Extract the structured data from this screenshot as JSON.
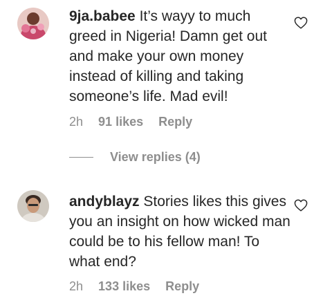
{
  "comments": [
    {
      "username": "9ja.babee",
      "text": "It’s wayy to much greed in Nigeria! Damn get out and make your own money instead of killing and taking someone’s life. Mad evil!",
      "time": "2h",
      "likes": "91 likes",
      "reply_label": "Reply",
      "avatar_icon": "avatar-photo",
      "like_icon": "heart-outline-icon",
      "view_replies_label": "View replies (4)"
    },
    {
      "username": "andyblayz",
      "text": "Stories likes this gives you an insight on how wicked man could be to his fellow man! To what end?",
      "time": "2h",
      "likes": "133 likes",
      "reply_label": "Reply",
      "avatar_icon": "avatar-photo",
      "like_icon": "heart-outline-icon"
    }
  ],
  "colors": {
    "text": "#262626",
    "secondary": "#8e8e8e",
    "background": "#ffffff"
  }
}
